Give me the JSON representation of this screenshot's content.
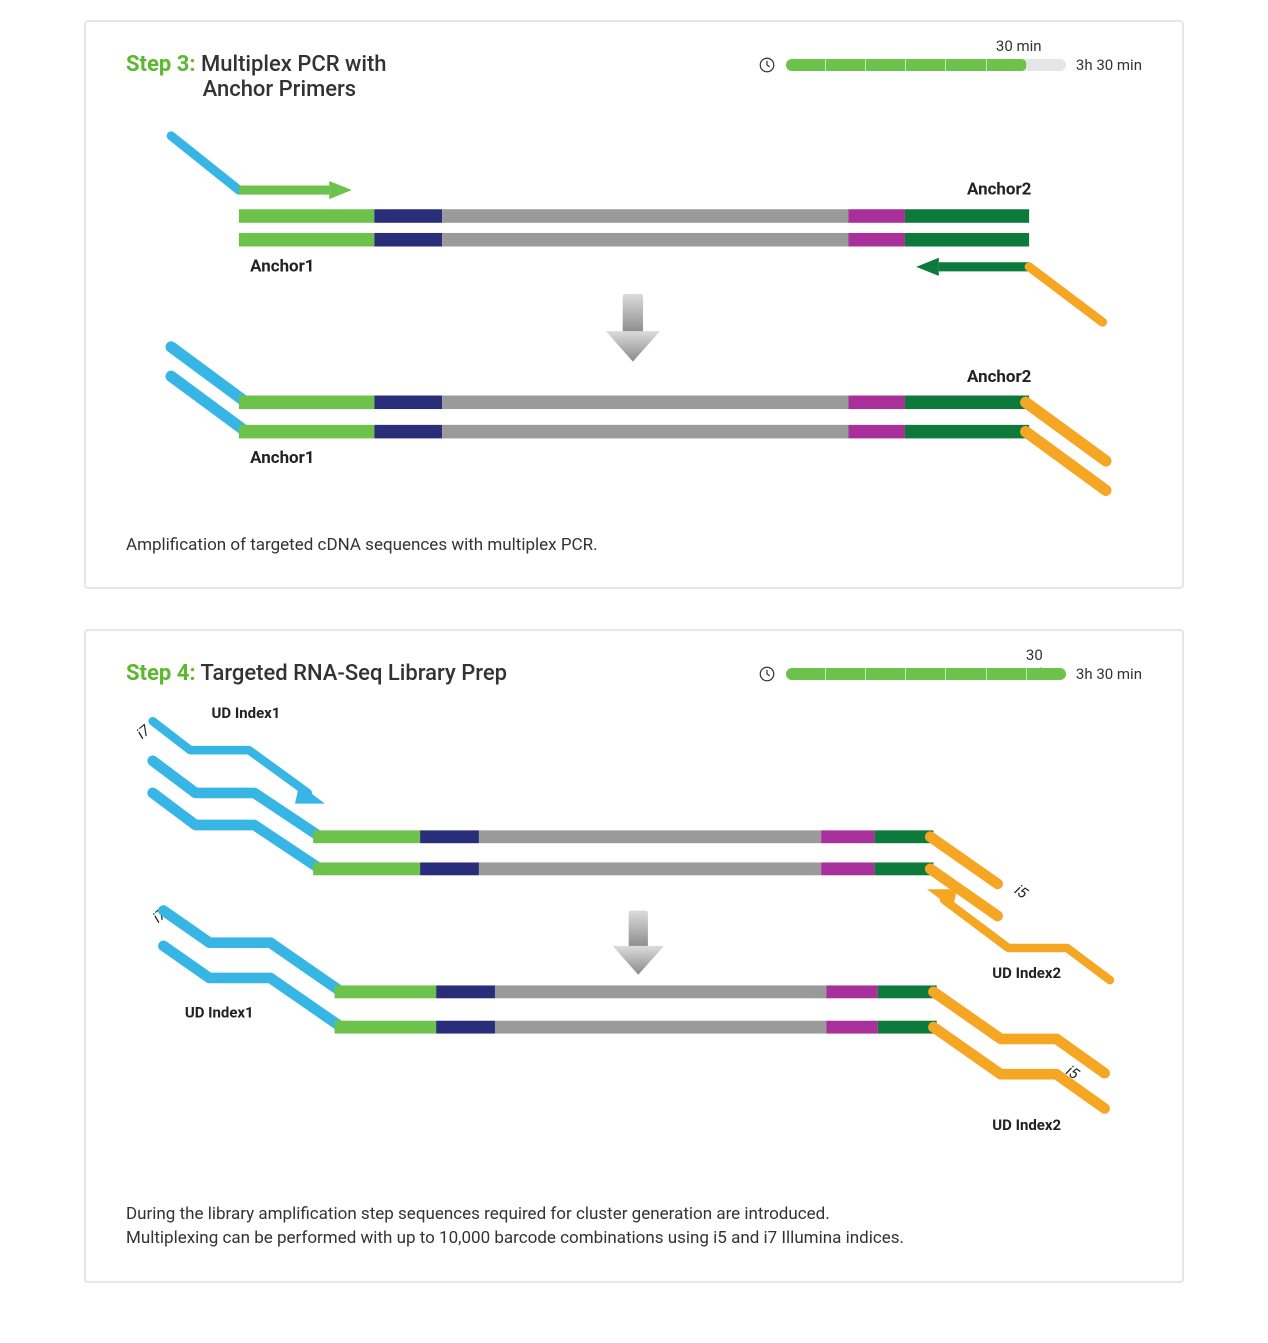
{
  "step3": {
    "label": "Step 3:",
    "title_line1": "Multiplex PCR with",
    "title_line2": "Anchor Primers",
    "time_segment": "30 min",
    "time_total": "3h 30 min",
    "progress_fraction": 0.86,
    "anchor1": "Anchor1",
    "anchor2": "Anchor2",
    "caption": "Amplification of targeted cDNA sequences with multiplex PCR."
  },
  "step4": {
    "label": "Step 4:",
    "title": "Targeted RNA-Seq Library Prep",
    "time_segment": "30 min",
    "time_total": "3h 30 min",
    "progress_fraction": 1.0,
    "ud_index1": "UD Index1",
    "ud_index2": "UD Index2",
    "i7": "i7",
    "i5": "i5",
    "caption_line1": "During the library amplification step sequences required for cluster generation are introduced.",
    "caption_line2": "Multiplexing can be performed with up to 10,000 barcode combinations using i5 and i7 Illumina indices."
  },
  "colors": {
    "cyan": "#37b6e6",
    "green_light": "#6cc24a",
    "green_dark": "#0d7a3c",
    "navy": "#2a2e7a",
    "gray": "#9a9a9a",
    "magenta": "#a8309a",
    "orange": "#f5a623",
    "arrow_gray": "#b0b0b0"
  }
}
